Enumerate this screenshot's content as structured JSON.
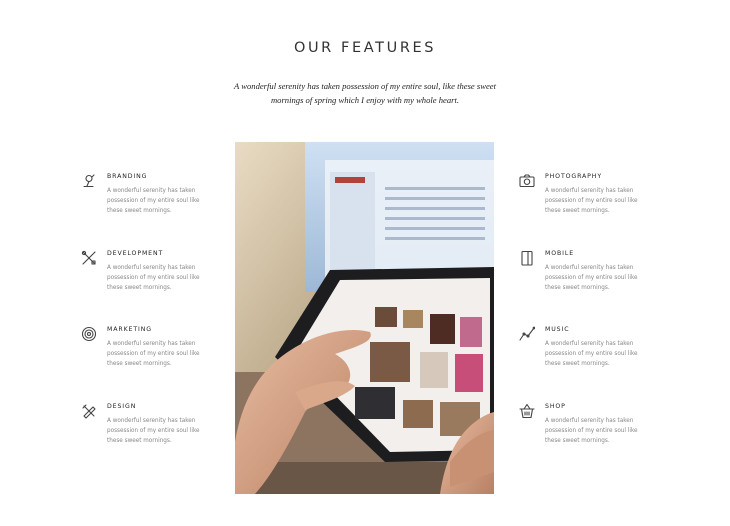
{
  "section": {
    "title": "OUR FEATURES",
    "subtitle_line1": "A wonderful serenity has taken possession of my entire soul, like these sweet",
    "subtitle_line2": "mornings of spring which I enjoy with my whole heart."
  },
  "features_left": [
    {
      "name": "BRANDING",
      "icon": "branding-icon",
      "desc1": "A wonderful serenity has taken",
      "desc2": "possession of my entire soul like",
      "desc3": "these sweet mornings."
    },
    {
      "name": "DEVELOPMENT",
      "icon": "tools-icon",
      "desc1": "A wonderful serenity has taken",
      "desc2": "possession of my entire soul like",
      "desc3": "these sweet mornings."
    },
    {
      "name": "MARKETING",
      "icon": "target-icon",
      "desc1": "A wonderful serenity has taken",
      "desc2": "possession of my entire soul like",
      "desc3": "these sweet mornings."
    },
    {
      "name": "DESIGN",
      "icon": "pencil-ruler-icon",
      "desc1": "A wonderful serenity has taken",
      "desc2": "possession of my entire soul like",
      "desc3": "these sweet mornings."
    }
  ],
  "features_right": [
    {
      "name": "PHOTOGRAPHY",
      "icon": "camera-icon",
      "desc1": "A wonderful serenity has taken",
      "desc2": "possession of my entire soul like",
      "desc3": "these sweet mornings."
    },
    {
      "name": "MOBILE",
      "icon": "mobile-icon",
      "desc1": "A wonderful serenity has taken",
      "desc2": "possession of my entire soul like",
      "desc3": "these sweet mornings."
    },
    {
      "name": "MUSIC",
      "icon": "chart-line-icon",
      "desc1": "A wonderful serenity has taken",
      "desc2": "possession of my entire soul like",
      "desc3": "these sweet mornings."
    },
    {
      "name": "SHOP",
      "icon": "basket-icon",
      "desc1": "A wonderful serenity has taken",
      "desc2": "possession of my entire soul like",
      "desc3": "these sweet mornings."
    }
  ],
  "photo": {
    "subject": "hands using tablet in front of laptop"
  },
  "colors": {
    "icon_stroke": "#444444",
    "text_muted": "#888888",
    "heading": "#333333"
  }
}
